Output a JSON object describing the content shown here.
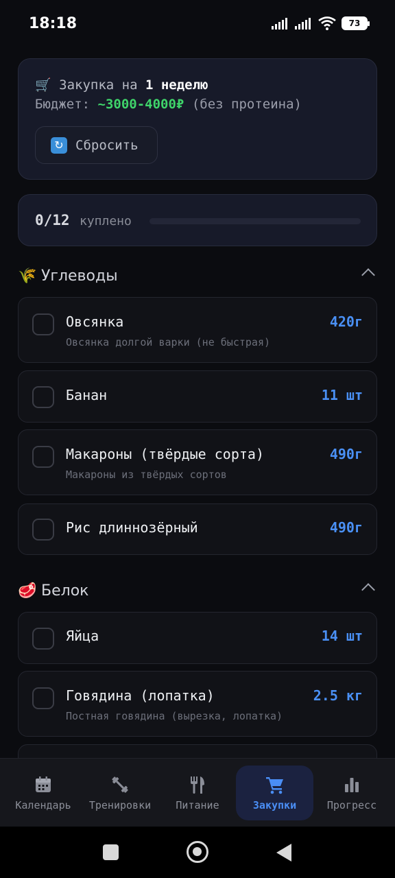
{
  "status_bar": {
    "time": "18:18",
    "battery": "73",
    "icons": [
      "signal-icon",
      "signal-icon",
      "wifi-icon",
      "battery-icon"
    ]
  },
  "header_card": {
    "cart_emoji": "🛒",
    "purchase_prefix": "Закупка на",
    "purchase_period": "1 неделю",
    "budget_label": "Бюджет:",
    "budget_value": "~3000-4000₽",
    "budget_note": "(без протеина)",
    "reset_icon": "🔄",
    "reset_label": "Сбросить"
  },
  "progress": {
    "count": "0/12",
    "label": "куплено",
    "fraction": 0
  },
  "sections": [
    {
      "emoji": "🌾",
      "title": "Углеводы",
      "items": [
        {
          "name": "Овсянка",
          "qty": "420г",
          "desc": "Овсянка долгой варки (не быстрая)"
        },
        {
          "name": "Банан",
          "qty": "11 шт",
          "desc": ""
        },
        {
          "name": "Макароны (твёрдые сорта)",
          "qty": "490г",
          "desc": "Макароны из твёрдых сортов"
        },
        {
          "name": "Рис длиннозёрный",
          "qty": "490г",
          "desc": ""
        }
      ]
    },
    {
      "emoji": "🥩",
      "title": "Белок",
      "items": [
        {
          "name": "Яйца",
          "qty": "14 шт",
          "desc": ""
        },
        {
          "name": "Говядина (лопатка)",
          "qty": "2.5 кг",
          "desc": "Постная говядина (вырезка, лопатка)"
        }
      ]
    }
  ],
  "bottom_nav": [
    {
      "label": "Календарь",
      "icon": "calendar-icon",
      "active": false
    },
    {
      "label": "Тренировки",
      "icon": "dumbbell-icon",
      "active": false
    },
    {
      "label": "Питание",
      "icon": "fork-knife-icon",
      "active": false
    },
    {
      "label": "Закупки",
      "icon": "cart-icon",
      "active": true
    },
    {
      "label": "Прогресс",
      "icon": "bar-chart-icon",
      "active": false
    }
  ],
  "colors": {
    "accent": "#4a90f5",
    "budget": "#3fd46a",
    "background": "#0b0c10"
  }
}
